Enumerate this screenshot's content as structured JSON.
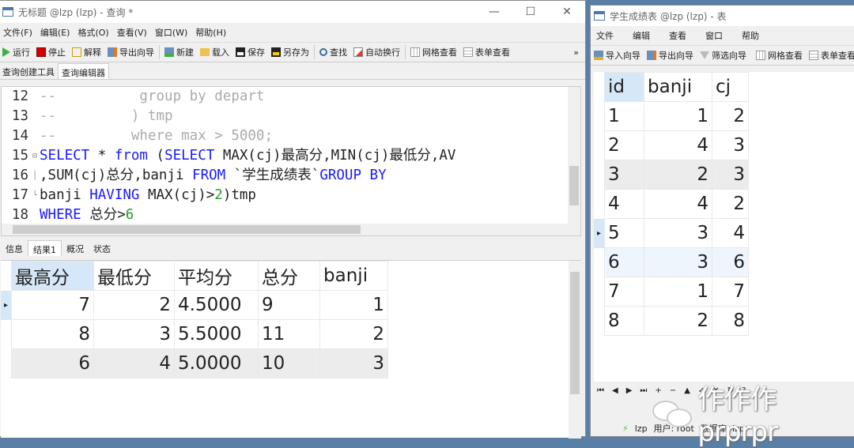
{
  "query_window": {
    "title": "无标题 @lzp (lzp) - 查询 *",
    "controls": {
      "minimize": "—",
      "maximize": "☐",
      "close": "✕"
    },
    "menu": [
      "文件(F)",
      "编辑(E)",
      "格式(O)",
      "查看(V)",
      "窗口(W)",
      "帮助(H)"
    ],
    "toolbar": {
      "run": "运行",
      "stop": "停止",
      "explain": "解释",
      "export_wizard": "导出向导",
      "new": "新建",
      "load": "载入",
      "save": "保存",
      "save_as": "另存为",
      "find": "查找",
      "word_wrap": "自动换行",
      "grid_view": "网格查看",
      "form_view": "表单查看",
      "overflow": "»"
    },
    "tabs": [
      "查询创建工具",
      "查询编辑器"
    ],
    "active_tab": "查询编辑器",
    "editor_lines": [
      {
        "num": "12",
        "fold": "",
        "segments": [
          {
            "t": "--          group by depart",
            "c": "cm"
          }
        ]
      },
      {
        "num": "13",
        "fold": "",
        "segments": [
          {
            "t": "--         ) tmp",
            "c": "cm"
          }
        ]
      },
      {
        "num": "14",
        "fold": "",
        "segments": [
          {
            "t": "--         where max > 5000;",
            "c": "cm"
          }
        ]
      },
      {
        "num": "15",
        "fold": "⊟",
        "segments": [
          {
            "t": "SELECT",
            "c": "kw"
          },
          {
            "t": " * ",
            "c": ""
          },
          {
            "t": "from",
            "c": "kw"
          },
          {
            "t": " (",
            "c": ""
          },
          {
            "t": "SELECT",
            "c": "kw"
          },
          {
            "t": " MAX(cj)最高分,MIN(cj)最低分,AV",
            "c": ""
          }
        ]
      },
      {
        "num": "16",
        "fold": "│",
        "segments": [
          {
            "t": ",SUM(cj)总分,banji ",
            "c": ""
          },
          {
            "t": "FROM",
            "c": "kw"
          },
          {
            "t": " `学生成绩表`",
            "c": ""
          },
          {
            "t": "GROUP BY",
            "c": "kw"
          }
        ]
      },
      {
        "num": "17",
        "fold": "└",
        "segments": [
          {
            "t": "banji ",
            "c": ""
          },
          {
            "t": "HAVING",
            "c": "kw"
          },
          {
            "t": " MAX(cj)>",
            "c": ""
          },
          {
            "t": "2",
            "c": "num"
          },
          {
            "t": ")tmp",
            "c": ""
          }
        ]
      },
      {
        "num": "18",
        "fold": "",
        "segments": [
          {
            "t": "WHERE",
            "c": "kw"
          },
          {
            "t": " 总分>",
            "c": ""
          },
          {
            "t": "6",
            "c": "num"
          }
        ]
      }
    ],
    "result_tabs": [
      "信息",
      "结果1",
      "概况",
      "状态"
    ],
    "active_result_tab": "结果1",
    "result": {
      "columns": [
        "最高分",
        "最低分",
        "平均分",
        "总分",
        "banji"
      ],
      "rows": [
        [
          "7",
          "2",
          "4.5000",
          "9",
          "1"
        ],
        [
          "8",
          "3",
          "5.5000",
          "11",
          "2"
        ],
        [
          "6",
          "4",
          "5.0000",
          "10",
          "3"
        ]
      ],
      "current_row_marker": "▸"
    }
  },
  "table_window": {
    "title": "学生成绩表 @lzp (lzp) - 表",
    "menu": [
      "文件",
      "编辑",
      "查看",
      "窗口",
      "帮助"
    ],
    "toolbar": {
      "import_wizard": "导入向导",
      "export_wizard": "导出向导",
      "filter_wizard": "筛选向导",
      "grid_view": "网格查看",
      "form_view": "表单查看"
    },
    "grid": {
      "columns": [
        "id",
        "banji",
        "cj"
      ],
      "rows": [
        [
          "1",
          "1",
          "2"
        ],
        [
          "2",
          "4",
          "3"
        ],
        [
          "3",
          "2",
          "3"
        ],
        [
          "4",
          "4",
          "2"
        ],
        [
          "5",
          "3",
          "4"
        ],
        [
          "6",
          "3",
          "6"
        ],
        [
          "7",
          "1",
          "7"
        ],
        [
          "8",
          "2",
          "8"
        ]
      ],
      "current_row_index": 4,
      "current_row_marker": "▸"
    },
    "nav_buttons": [
      "⏮",
      "◀",
      "▶",
      "⏭",
      "+",
      "−",
      "▲",
      "✓",
      "✕",
      "↻",
      "?"
    ],
    "status": {
      "connection": "lzp",
      "user": "用户: root",
      "database": "数据库: lzp"
    }
  },
  "watermark": "作作作prprpr"
}
